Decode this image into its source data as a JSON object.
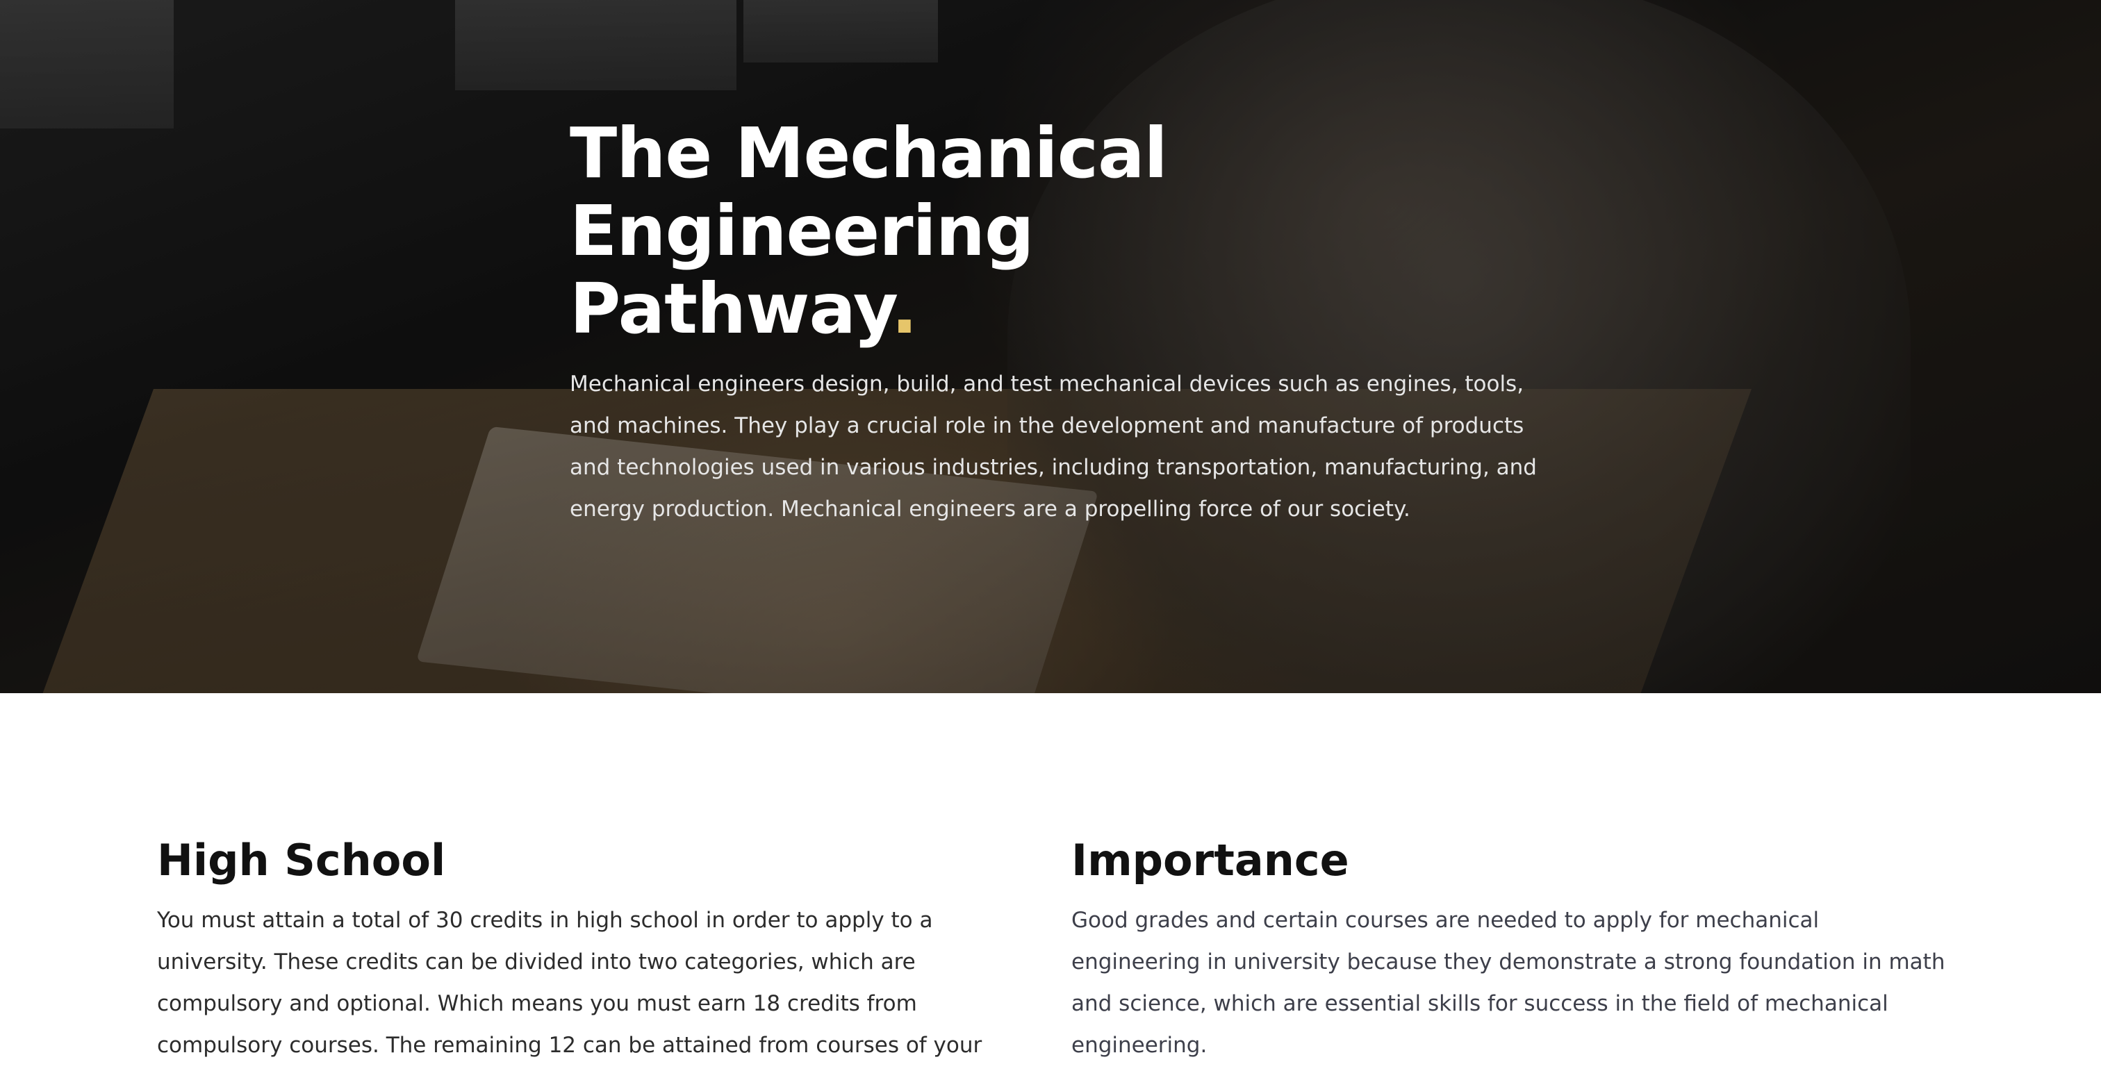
{
  "hero": {
    "title": "The Mechanical Engineering Pathway",
    "title_dot": ".",
    "description": "Mechanical engineers design, build, and test mechanical devices such as engines, tools, and machines. They play a crucial role in the development and manufacture of products and technologies used in various industries, including transportation, manufacturing, and energy production. Mechanical engineers are a propelling force of our society.",
    "accent_color": "#e6c56a"
  },
  "sections": {
    "high_school": {
      "heading": "High School",
      "body": "You must attain a total of 30 credits in high school in order to apply to a university. These credits can be divided into two categories, which are compulsory and optional. Which means you must earn 18 credits from compulsory courses. The remaining 12 can be attained from courses of your"
    },
    "importance": {
      "heading": "Importance",
      "body": "Good grades and certain courses are needed to apply for mechanical engineering in university because they demonstrate a strong foundation in math and science, which are essential skills for success in the field of mechanical engineering."
    }
  }
}
